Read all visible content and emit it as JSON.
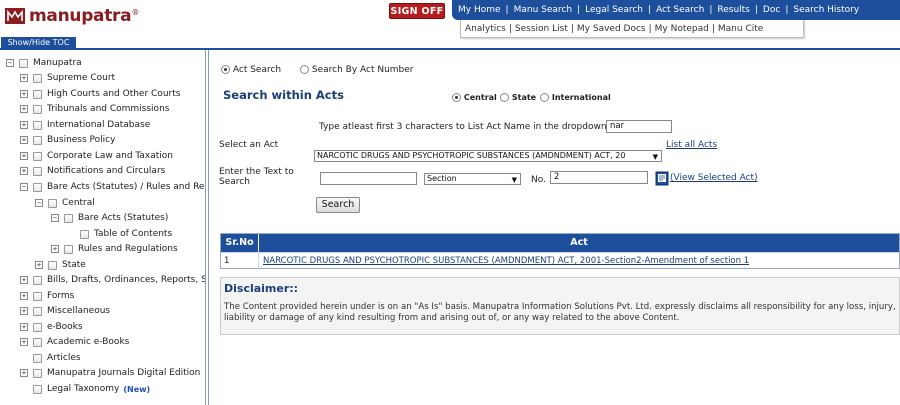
{
  "header": {
    "logo_text": "manupatra",
    "logo_reg": "®",
    "signoff_label": "SIGN OFF",
    "nav": [
      "My Home",
      "Manu Search",
      "Legal Search",
      "Act Search",
      "Results",
      "Doc",
      "Search History"
    ],
    "subnav": [
      "Analytics",
      "Session List",
      "My Saved Docs",
      "My Notepad",
      "Manu Cite"
    ],
    "toc_label": "Show/Hide TOC"
  },
  "sidebar": {
    "root": "Manupatra",
    "items": [
      "Supreme Court",
      "High Courts and Other Courts",
      "Tribunals and Commissions",
      "International Database",
      "Business Policy",
      "Corporate Law and Taxation",
      "Notifications and Circulars",
      "Bare Acts (Statutes) / Rules and Re",
      "Central",
      "Bare Acts (Statutes)",
      "Table of Contents",
      "Rules and Regulations",
      "State",
      "Bills, Drafts, Ordinances, Reports, S",
      "Forms",
      "Miscellaneous",
      "e-Books",
      "Academic e-Books",
      "Articles",
      "Manupatra Journals Digital Edition",
      "Legal Taxonomy"
    ],
    "new_tag": "(New)"
  },
  "search": {
    "mode_act": "Act Search",
    "mode_number": "Search By Act Number",
    "title": "Search within Acts",
    "scope_central": "Central",
    "scope_state": "State",
    "scope_international": "International",
    "hint": "Type atleast first 3 characters to List Act Name in the dropdown",
    "act_prefix_value": "nar",
    "select_act_label": "Select an Act",
    "list_all_label": "List all Acts",
    "selected_act": "NARCOTIC DRUGS AND PSYCHOTROPIC SUBSTANCES (AMDNDMENT) ACT, 20",
    "enter_text_label_1": "Enter the Text to",
    "enter_text_label_2": "Search",
    "text_value": "",
    "section_option": "Section",
    "no_label": "No.",
    "no_value": "2",
    "view_selected": "(View Selected Act)",
    "search_button": "Search"
  },
  "results": {
    "col_srno": "Sr.No",
    "col_act": "Act",
    "rows": [
      {
        "srno": "1",
        "act": "NARCOTIC DRUGS AND PSYCHOTROPIC SUBSTANCES (AMDNDMENT) ACT, 2001-Section2-Amendment of section 1"
      }
    ]
  },
  "disclaimer": {
    "title": "Disclaimer::",
    "text": "The Content provided herein under is on an \"As Is\" basis. Manupatra Information Solutions Pvt. Ltd. expressly disclaims all responsibility for any loss, injury, liability or damage of any kind resulting from and arising out of, or any way related to the above Content."
  },
  "colors": {
    "brand": "#8b1c20",
    "nav_blue": "#1e4f9c",
    "signoff_red": "#b41e1e",
    "title_blue": "#1a3e7a"
  }
}
